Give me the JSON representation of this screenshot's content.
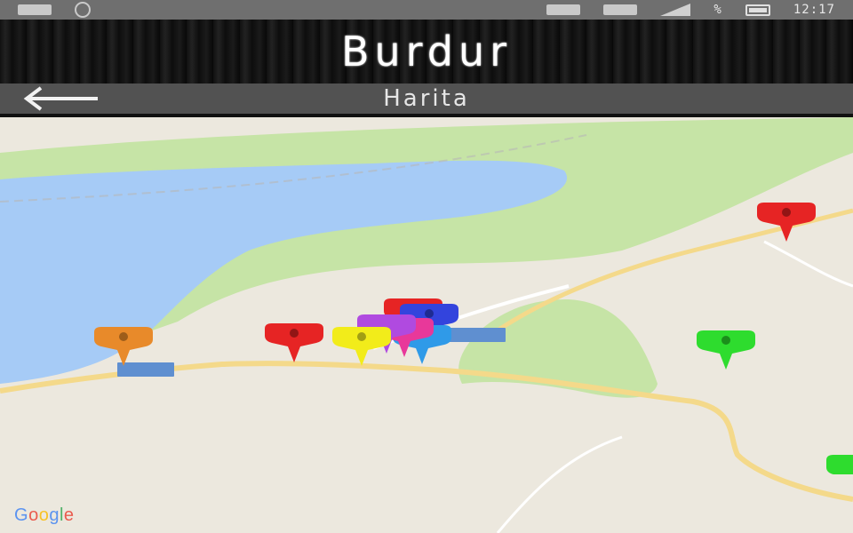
{
  "status_bar": {
    "battery_text": "%",
    "time": "12:17"
  },
  "header": {
    "title": "Burdur"
  },
  "nav": {
    "back_icon": "arrow-left-icon",
    "title": "Harita"
  },
  "map": {
    "colors": {
      "land": "#ece8de",
      "water": "#a6cbf6",
      "park": "#c6e4a6",
      "road": "#f4d98a"
    },
    "markers": [
      {
        "color": "#e84a1a",
        "icon": "map-pin-icon"
      },
      {
        "color": "#e62424",
        "icon": "map-pin-icon"
      },
      {
        "color": "#e62424",
        "icon": "map-pin-icon"
      },
      {
        "color": "#f2ec1a",
        "icon": "map-pin-icon"
      },
      {
        "color": "#3344dd",
        "icon": "map-pin-icon"
      },
      {
        "color": "#e62424",
        "icon": "map-pin-icon"
      },
      {
        "color": "#2edc2e",
        "icon": "map-pin-icon"
      },
      {
        "color": "#2edc2e",
        "icon": "map-pin-icon"
      }
    ],
    "attribution": "Google"
  }
}
